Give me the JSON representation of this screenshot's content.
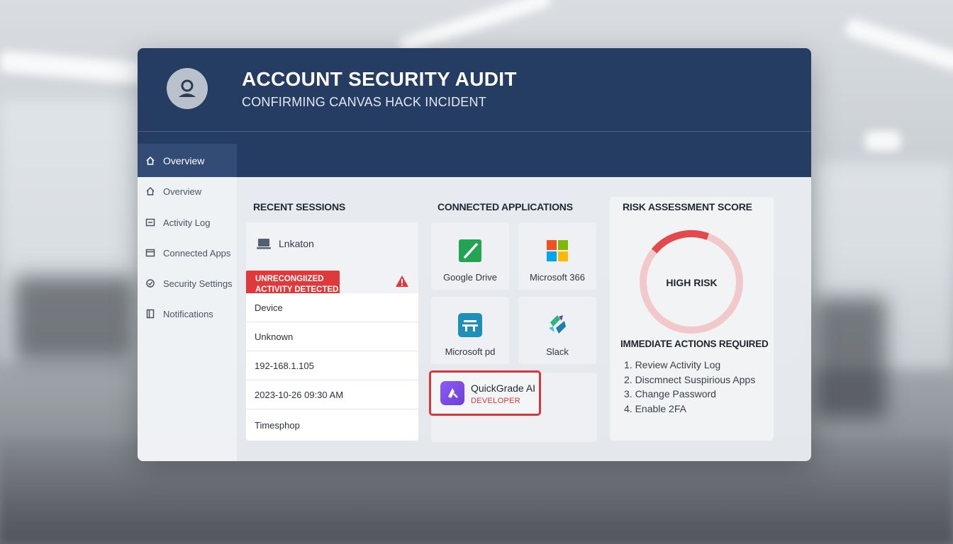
{
  "header": {
    "title": "ACCOUNT SECURITY AUDIT",
    "subtitle": "CONFIRMING CANVAS HACK INCIDENT"
  },
  "sidebar": {
    "items": [
      {
        "label": "Overview",
        "icon": "home-icon",
        "active": true
      },
      {
        "label": "Overview",
        "icon": "home-icon",
        "active": false
      },
      {
        "label": "Activity Log",
        "icon": "list-icon",
        "active": false
      },
      {
        "label": "Connected Apps",
        "icon": "apps-icon",
        "active": false
      },
      {
        "label": "Security Settings",
        "icon": "shield-icon",
        "active": false
      },
      {
        "label": "Notifications",
        "icon": "bell-icon",
        "active": false
      }
    ]
  },
  "sessions": {
    "title": "RECENT SESSIONS",
    "device_name": "Lnkaton",
    "alert_line1": "UNRECONGIIZED",
    "alert_line2": "ACTIVITY DETECTED",
    "rows": [
      "Device",
      "Unknown",
      "192-168.1.105",
      "2023-10-26 09:30 AM",
      "Timesphop"
    ]
  },
  "apps": {
    "title": "CONNECTED APPLICATIONS",
    "items": [
      {
        "name": "Google Drive",
        "icon": "drive-icon"
      },
      {
        "name": "Microsoft 366",
        "icon": "microsoft-icon"
      },
      {
        "name": "Microsoft pd",
        "icon": "planner-icon"
      },
      {
        "name": "Slack",
        "icon": "slack-icon"
      }
    ],
    "flagged": {
      "name": "QuickGrade AI",
      "role": "DEVELOPER",
      "highlight_color": "#d8363a"
    }
  },
  "risk": {
    "title": "RISK ASSESSMENT SCORE",
    "level": "HIGH RISK",
    "actions_title": "IMMEDIATE ACTIONS REQUIRED",
    "actions": [
      "1. Review Activity Log",
      "2. Discmnect Suspirious Apps",
      "3. Change Password",
      "4. Enable 2FA"
    ]
  },
  "colors": {
    "header": "#263d63",
    "sidebar_active": "#324c75",
    "alert": "#e0393b",
    "gauge": "#e24a4c",
    "gauge_track": "#f2c9cb"
  }
}
